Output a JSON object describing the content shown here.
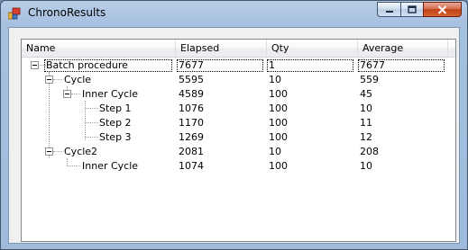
{
  "window": {
    "title": "ChronoResults"
  },
  "columns": [
    "Name",
    "Elapsed",
    "Qty",
    "Average"
  ],
  "rows": [
    {
      "name": "Batch procedure",
      "elapsed": "7677",
      "qty": "1",
      "average": "7677"
    },
    {
      "name": "Cycle",
      "elapsed": "5595",
      "qty": "10",
      "average": "559"
    },
    {
      "name": "Inner Cycle",
      "elapsed": "4589",
      "qty": "100",
      "average": "45"
    },
    {
      "name": "Step 1",
      "elapsed": "1076",
      "qty": "100",
      "average": "10"
    },
    {
      "name": "Step 2",
      "elapsed": "1170",
      "qty": "100",
      "average": "11"
    },
    {
      "name": "Step 3",
      "elapsed": "1269",
      "qty": "100",
      "average": "12"
    },
    {
      "name": "Cycle2",
      "elapsed": "2081",
      "qty": "10",
      "average": "208"
    },
    {
      "name": "Inner Cycle",
      "elapsed": "1074",
      "qty": "100",
      "average": "10"
    }
  ],
  "icons": {
    "app": "app-icon",
    "minimize": "minimize-icon",
    "maximize": "maximize-icon",
    "close": "close-icon",
    "expander": "collapse-icon"
  }
}
